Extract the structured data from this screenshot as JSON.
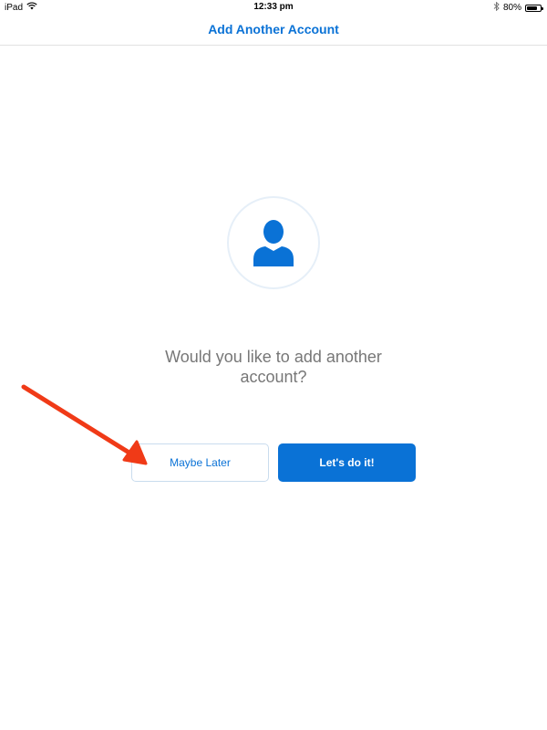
{
  "status_bar": {
    "device": "iPad",
    "time": "12:33 pm",
    "battery_percent": "80%",
    "battery_level": 0.8,
    "icons": [
      "wifi-icon",
      "bluetooth-icon",
      "battery-icon"
    ]
  },
  "nav": {
    "title": "Add Another Account"
  },
  "main": {
    "avatar_icon": "person-icon",
    "question": "Would you like to add another account?",
    "maybe_later_label": "Maybe Later",
    "lets_do_it_label": "Let's do it!"
  },
  "colors": {
    "accent": "#0a72d6",
    "annotation": "#f03a17"
  }
}
